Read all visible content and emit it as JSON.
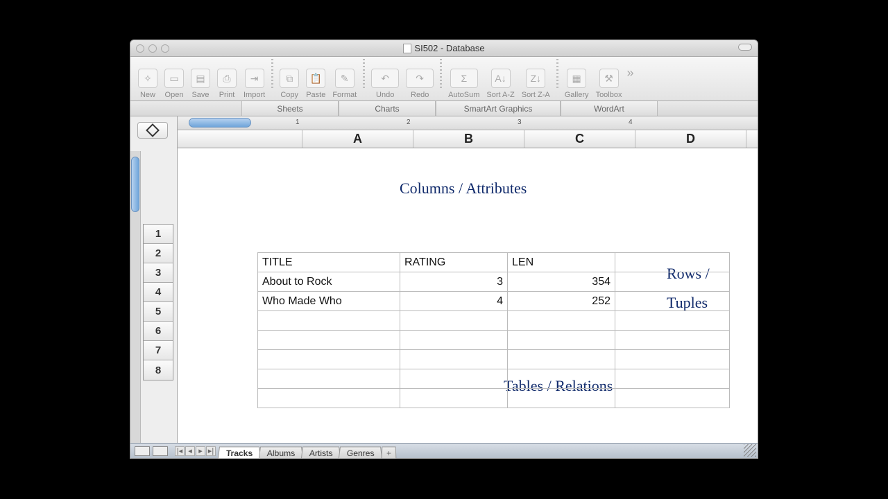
{
  "titlebar": {
    "title": "SI502 - Database"
  },
  "toolbar": {
    "items": [
      {
        "label": "New"
      },
      {
        "label": "Open"
      },
      {
        "label": "Save"
      },
      {
        "label": "Print"
      },
      {
        "label": "Import"
      },
      {
        "label": "Copy"
      },
      {
        "label": "Paste"
      },
      {
        "label": "Format"
      },
      {
        "label": "Undo"
      },
      {
        "label": "Redo"
      },
      {
        "label": "AutoSum"
      },
      {
        "label": "Sort A-Z"
      },
      {
        "label": "Sort Z-A"
      },
      {
        "label": "Gallery"
      },
      {
        "label": "Toolbox"
      }
    ]
  },
  "subtabs": [
    "Sheets",
    "Charts",
    "SmartArt Graphics",
    "WordArt"
  ],
  "ruler_ticks": [
    "1",
    "2",
    "3",
    "4"
  ],
  "columns": [
    "A",
    "B",
    "C",
    "D"
  ],
  "rownums": [
    "1",
    "2",
    "3",
    "4",
    "5",
    "6",
    "7",
    "8"
  ],
  "annotations": {
    "columns": "Columns / Attributes",
    "rows1": "Rows /",
    "rows2": "Tuples",
    "tables": "Tables / Relations"
  },
  "table": {
    "headers": [
      "TITLE",
      "RATING",
      "LEN"
    ],
    "rows": [
      {
        "title": "About to Rock",
        "rating": "3",
        "len": "354"
      },
      {
        "title": "Who Made Who",
        "rating": "4",
        "len": "252"
      }
    ]
  },
  "sheet_tabs": [
    "Tracks",
    "Albums",
    "Artists",
    "Genres"
  ],
  "add_tab": "+"
}
